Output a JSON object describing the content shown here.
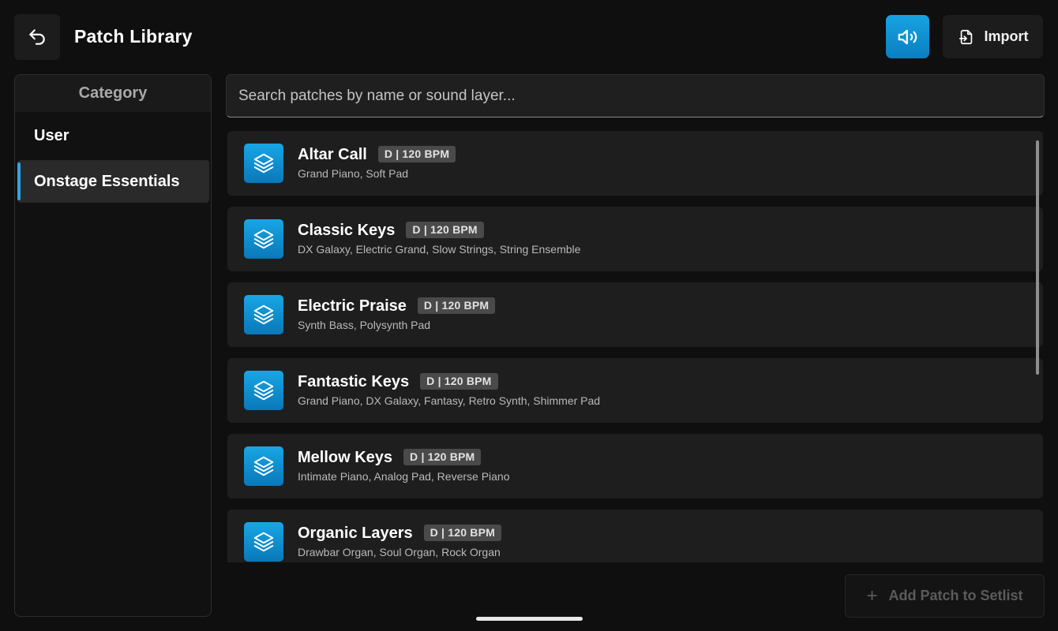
{
  "header": {
    "title": "Patch Library",
    "back_icon": "undo-arrow-icon",
    "speaker_icon": "speaker-volume-icon",
    "import_icon": "file-import-icon",
    "import_label": "Import",
    "accent_color": "#1296d4"
  },
  "sidebar": {
    "title": "Category",
    "items": [
      {
        "label": "User",
        "selected": false
      },
      {
        "label": "Onstage Essentials",
        "selected": true
      }
    ]
  },
  "search": {
    "placeholder": "Search patches by name or sound layer...",
    "value": ""
  },
  "patches": [
    {
      "name": "Altar Call",
      "badge": "D | 120 BPM",
      "layers": "Grand Piano, Soft Pad"
    },
    {
      "name": "Classic Keys",
      "badge": "D | 120 BPM",
      "layers": "DX Galaxy, Electric Grand, Slow Strings, String Ensemble"
    },
    {
      "name": "Electric Praise",
      "badge": "D | 120 BPM",
      "layers": "Synth Bass, Polysynth Pad"
    },
    {
      "name": "Fantastic Keys",
      "badge": "D | 120 BPM",
      "layers": "Grand Piano, DX Galaxy, Fantasy, Retro Synth, Shimmer Pad"
    },
    {
      "name": "Mellow Keys",
      "badge": "D | 120 BPM",
      "layers": "Intimate Piano, Analog Pad, Reverse Piano"
    },
    {
      "name": "Organic Layers",
      "badge": "D | 120 BPM",
      "layers": "Drawbar Organ, Soul Organ, Rock Organ"
    }
  ],
  "footer": {
    "add_label": "Add Patch to Setlist",
    "add_icon": "plus-icon",
    "add_enabled": false
  }
}
